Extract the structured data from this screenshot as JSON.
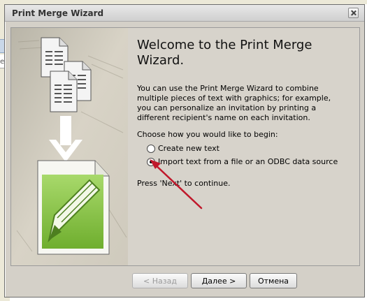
{
  "window": {
    "title": "Print Merge Wizard"
  },
  "background": {
    "fragment_line1": "",
    "fragment_line2": "ea"
  },
  "wizard": {
    "heading": "Welcome to the Print Merge Wizard.",
    "description": "You can use the Print Merge Wizard to combine multiple pieces of text with graphics; for example, you can personalize an invitation by printing a different recipient's name on each invitation.",
    "choose_prompt": "Choose how you would like to begin:",
    "options": [
      {
        "label": "Create new text",
        "selected": false
      },
      {
        "label": "Import text from a file or an ODBC data source",
        "selected": true
      }
    ],
    "continue_hint": "Press 'Next' to continue."
  },
  "buttons": {
    "back": "< Назад",
    "next": "Далее >",
    "cancel": "Отмена"
  },
  "colors": {
    "annotation_arrow": "#c0182b",
    "graphic_green": "#8cc63f"
  },
  "icons": [
    "close-icon",
    "document-stack-icon",
    "down-arrow-icon",
    "pencil-document-icon"
  ]
}
